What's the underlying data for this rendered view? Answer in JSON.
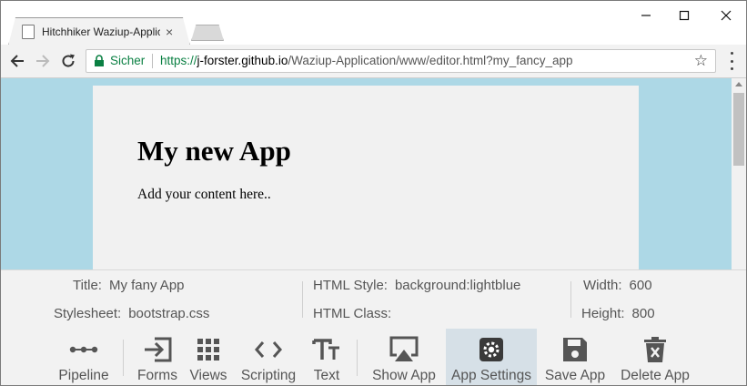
{
  "browser": {
    "tab_title": "Hitchhiker Waziup-Application",
    "tab_close": "×",
    "secure_label": "Sicher",
    "url_scheme": "https://",
    "url_host": "j-forster.github.io",
    "url_path": "/Waziup-Application/www/editor.html?my_fancy_app",
    "window_controls": {
      "minimize": "—",
      "maximize": "☐",
      "close": "✕"
    }
  },
  "app_preview": {
    "title": "My new App",
    "content": "Add your content here..",
    "background_color": "#add8e6"
  },
  "settings": {
    "title_label": "Title:",
    "title_value": "My fany App",
    "stylesheet_label": "Stylesheet:",
    "stylesheet_value": "bootstrap.css",
    "html_style_label": "HTML Style:",
    "html_style_value": "background:lightblue",
    "html_class_label": "HTML Class:",
    "html_class_value": "",
    "width_label": "Width:",
    "width_value": "600",
    "height_label": "Height:",
    "height_value": "800"
  },
  "toolbar": {
    "items": [
      {
        "label": "Pipeline",
        "icon": "pipeline-icon"
      },
      {
        "label": "Forms",
        "icon": "sign-in-icon"
      },
      {
        "label": "Views",
        "icon": "grid-icon"
      },
      {
        "label": "Scripting",
        "icon": "code-icon"
      },
      {
        "label": "Text",
        "icon": "text-icon"
      },
      {
        "label": "Show App",
        "icon": "airplay-icon"
      },
      {
        "label": "App Settings",
        "icon": "settings-gear-icon",
        "active": true
      },
      {
        "label": "Save App",
        "icon": "floppy-disk-icon"
      },
      {
        "label": "Delete App",
        "icon": "trash-icon"
      }
    ]
  }
}
